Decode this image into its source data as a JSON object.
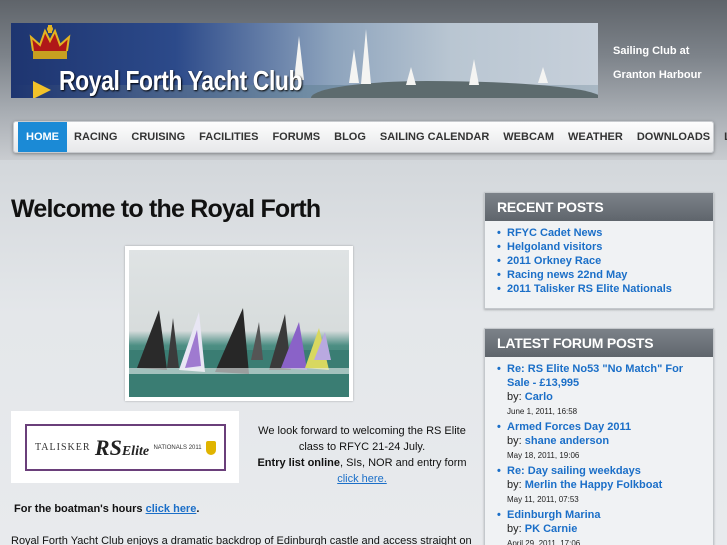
{
  "header": {
    "site_title": "Royal Forth Yacht Club",
    "tagline_line1": "Sailing Club at",
    "tagline_line2": "Granton Harbour"
  },
  "nav": {
    "items": [
      {
        "label": "HOME",
        "active": true
      },
      {
        "label": "RACING"
      },
      {
        "label": "CRUISING"
      },
      {
        "label": "FACILITIES"
      },
      {
        "label": "FORUMS"
      },
      {
        "label": "BLOG"
      },
      {
        "label": "SAILING CALENDAR"
      },
      {
        "label": "WEBCAM"
      },
      {
        "label": "WEATHER"
      },
      {
        "label": "DOWNLOADS"
      },
      {
        "label": "LINKS"
      }
    ]
  },
  "main": {
    "title": "Welcome to the Royal Forth",
    "logo": {
      "talisker": "TALISKER",
      "rs": "RS",
      "elite": "Elite",
      "nationals": "NATIONALS 2011"
    },
    "welcome_line1": "We look forward to welcoming the RS Elite",
    "welcome_line2": "class to RFYC 21-24 July.",
    "entry_bold": "Entry list online",
    "entry_rest": ",  SIs, NOR and entry form",
    "entry_link": "click here.",
    "boatman_text": "For the boatman's hours ",
    "boatman_link": "click here",
    "boatman_end": ".",
    "body_text": "Royal Forth Yacht Club enjoys a dramatic backdrop of Edinburgh castle and access straight on"
  },
  "sidebar": {
    "recent_posts": {
      "heading": "RECENT POSTS",
      "items": [
        "RFYC Cadet News",
        "Helgoland visitors",
        "2011 Orkney Race",
        "Racing news 22nd May",
        "2011 Talisker RS Elite Nationals"
      ]
    },
    "forum_posts": {
      "heading": "LATEST FORUM POSTS",
      "by_label": "by:",
      "items": [
        {
          "title_line1": "Re: RS Elite No53 \"No Match\" For",
          "title_line2": "Sale - £13,995",
          "author": "Carlo",
          "date": "June 1, 2011, 16:58"
        },
        {
          "title_line1": "Armed Forces Day 2011",
          "title_line2": "",
          "author": "shane anderson",
          "date": "May 18, 2011, 19:06"
        },
        {
          "title_line1": "Re: Day sailing weekdays",
          "title_line2": "",
          "author": "Merlin the Happy Folkboat",
          "date": "May 11, 2011, 07:53"
        },
        {
          "title_line1": "Edinburgh Marina",
          "title_line2": "",
          "author": "PK Carnie",
          "date": "April 29, 2011, 17:06"
        }
      ]
    }
  }
}
